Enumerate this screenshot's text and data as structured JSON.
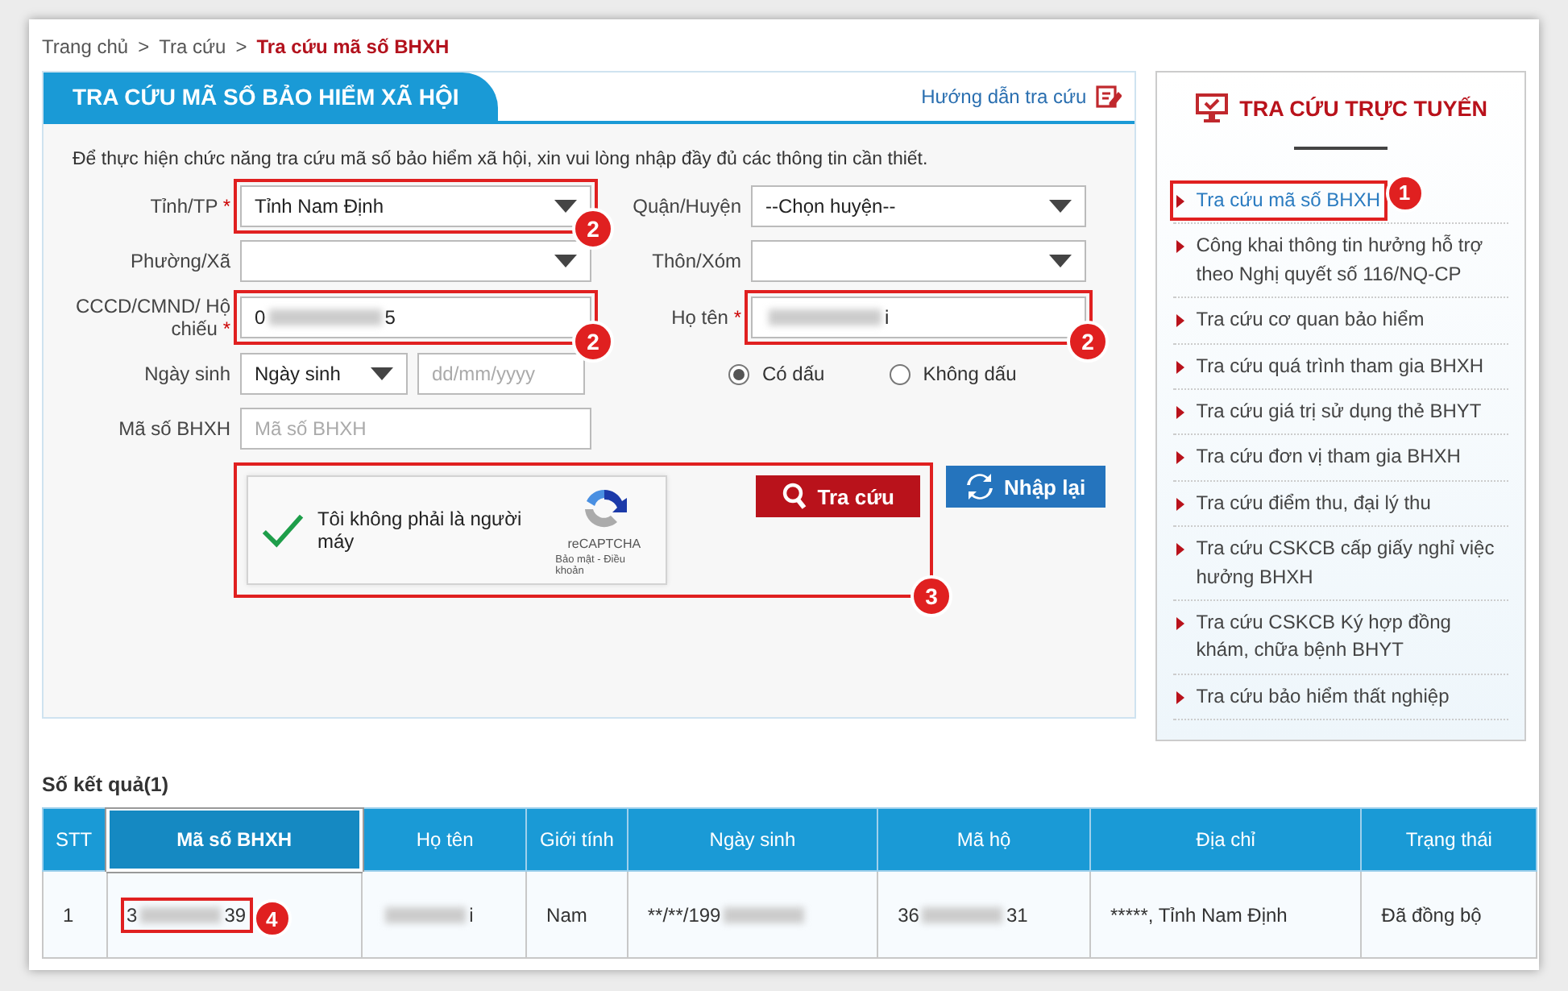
{
  "breadcrumb": [
    {
      "label": "Trang chủ",
      "separator": ">",
      "current": false
    },
    {
      "label": "Tra cứu",
      "separator": ">",
      "current": false
    },
    {
      "label": "Tra cứu mã số BHXH",
      "current": true
    }
  ],
  "panel": {
    "title": "TRA CỨU MÃ SỐ BẢO HIỂM XÃ HỘI",
    "help_link": "Hướng dẫn tra cứu",
    "intro": "Để thực hiện chức năng tra cứu mã số bảo hiểm xã hội, xin vui lòng nhập đầy đủ các thông tin cần thiết."
  },
  "form": {
    "rows": [
      [
        {
          "kind": "select",
          "label": "Tỉnh/TP",
          "required_mark": "*",
          "value": "Tỉnh Nam Định",
          "annotation": "2"
        },
        {
          "kind": "select",
          "label": "Quận/Huyện",
          "value": "--Chọn huyện--"
        }
      ],
      [
        {
          "kind": "select",
          "label": "Phường/Xã"
        },
        {
          "kind": "select",
          "label": "Thôn/Xóm"
        }
      ],
      [
        {
          "kind": "text",
          "label": "CCCD/CMND/ Hộ chiếu",
          "required_mark": "*",
          "value_start": "0",
          "value_end": "5",
          "redacted": true,
          "annotation": "2"
        },
        {
          "kind": "text",
          "label": "Họ tên",
          "required_mark": "*",
          "value_end": "i",
          "redacted": true,
          "annotation": "2"
        }
      ],
      [
        {
          "kind": "birth",
          "label": "Ngày sinh",
          "select_value": "Ngày sinh",
          "placeholder": "dd/mm/yyyy"
        },
        {
          "kind": "radios",
          "options": [
            {
              "label": "Có dấu",
              "selected": true
            },
            {
              "label": "Không dấu",
              "selected": false
            }
          ]
        }
      ],
      [
        {
          "kind": "text",
          "label": "Mã số BHXH",
          "placeholder": "Mã số BHXH"
        }
      ]
    ]
  },
  "captcha": {
    "checked": true,
    "text": "Tôi không phải là người máy",
    "brand": "reCAPTCHA",
    "links": "Bảo mật - Điều khoản",
    "annotation": "3"
  },
  "buttons": [
    {
      "kind": "search",
      "label": "Tra cứu"
    },
    {
      "kind": "reset",
      "label": "Nhập lại"
    }
  ],
  "sidebar": {
    "title": "TRA CỨU TRỰC TUYẾN",
    "items": [
      {
        "label": "Tra cứu mã số BHXH",
        "selected": true,
        "annotation": "1"
      },
      {
        "label": "Công khai thông tin hưởng hỗ trợ theo Nghị quyết số 116/NQ-CP",
        "selected": false
      },
      {
        "label": "Tra cứu cơ quan bảo hiểm",
        "selected": false
      },
      {
        "label": "Tra cứu quá trình tham gia BHXH",
        "selected": false
      },
      {
        "label": "Tra cứu giá trị sử dụng thẻ BHYT",
        "selected": false
      },
      {
        "label": "Tra cứu đơn vị tham gia BHXH",
        "selected": false
      },
      {
        "label": "Tra cứu điểm thu, đại lý thu",
        "selected": false
      },
      {
        "label": "Tra cứu CSKCB cấp giấy nghỉ việc hưởng BHXH",
        "selected": false
      },
      {
        "label": "Tra cứu CSKCB Ký hợp đồng khám, chữa bệnh BHYT",
        "selected": false
      },
      {
        "label": "Tra cứu bảo hiểm thất nghiệp",
        "selected": false
      }
    ]
  },
  "results": {
    "label": "Số kết quả(1)",
    "columns": [
      {
        "label": "STT",
        "highlighted": false
      },
      {
        "label": "Mã số BHXH",
        "highlighted": true
      },
      {
        "label": "Họ tên",
        "highlighted": false
      },
      {
        "label": "Giới tính",
        "highlighted": false
      },
      {
        "label": "Ngày sinh",
        "highlighted": false
      },
      {
        "label": "Mã hộ",
        "highlighted": false
      },
      {
        "label": "Địa chỉ",
        "highlighted": false
      },
      {
        "label": "Trạng thái",
        "highlighted": false
      }
    ],
    "rows": [
      [
        {
          "text": "1"
        },
        {
          "start": "3",
          "end": "39",
          "redacted": true,
          "annotation": "4"
        },
        {
          "end": "i",
          "redacted": true
        },
        {
          "text": "Nam"
        },
        {
          "start": "**/**/199",
          "redacted": true
        },
        {
          "start": "36",
          "end": "31",
          "redacted": true
        },
        {
          "text": "*****, Tỉnh Nam Định"
        },
        {
          "text": "Đã đồng bộ"
        }
      ]
    ]
  }
}
